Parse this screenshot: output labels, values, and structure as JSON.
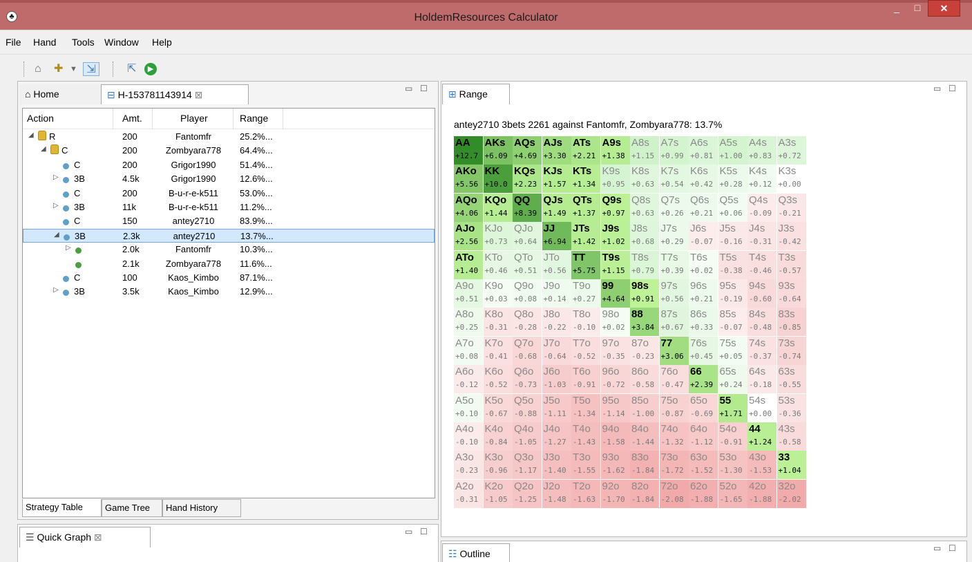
{
  "window": {
    "title": "HoldemResources Calculator",
    "minimize": "_",
    "maximize": "□",
    "close": "✕"
  },
  "menu": [
    "File",
    "Hand",
    "Tools",
    "Window",
    "Help"
  ],
  "left": {
    "tabs": {
      "home": "Home",
      "hand": "H-153781143914"
    },
    "columns": {
      "action": "Action",
      "amt": "Amt.",
      "player": "Player",
      "range": "Range"
    },
    "rows": [
      {
        "indent": 0,
        "exp": "◢",
        "icon": "lock",
        "action": "R",
        "amt": "200",
        "player": "Fantomfr",
        "range": "25.2%..."
      },
      {
        "indent": 1,
        "exp": "◢",
        "icon": "lock",
        "action": "C",
        "amt": "200",
        "player": "Zombyara778",
        "range": "64.4%..."
      },
      {
        "indent": 2,
        "exp": "",
        "icon": "dot",
        "action": "C",
        "amt": "200",
        "player": "Grigor1990",
        "range": "51.4%..."
      },
      {
        "indent": 2,
        "exp": "▷",
        "icon": "dot",
        "action": "3B",
        "amt": "4.5k",
        "player": "Grigor1990",
        "range": "12.6%..."
      },
      {
        "indent": 2,
        "exp": "",
        "icon": "dot",
        "action": "C",
        "amt": "200",
        "player": "B-u-r-e-k511",
        "range": "53.0%..."
      },
      {
        "indent": 2,
        "exp": "▷",
        "icon": "dot",
        "action": "3B",
        "amt": "11k",
        "player": "B-u-r-e-k511",
        "range": "11.2%..."
      },
      {
        "indent": 2,
        "exp": "",
        "icon": "dot",
        "action": "C",
        "amt": "150",
        "player": "antey2710",
        "range": "83.9%..."
      },
      {
        "indent": 2,
        "exp": "◢",
        "icon": "dot",
        "action": "3B",
        "amt": "2.3k",
        "player": "antey2710",
        "range": "13.7%...",
        "selected": true
      },
      {
        "indent": 3,
        "exp": "▷",
        "icon": "gdot",
        "action": "",
        "amt": "2.0k",
        "player": "Fantomfr",
        "range": "10.3%..."
      },
      {
        "indent": 3,
        "exp": "",
        "icon": "gdot",
        "action": "",
        "amt": "2.1k",
        "player": "Zombyara778",
        "range": "11.6%..."
      },
      {
        "indent": 2,
        "exp": "",
        "icon": "dot",
        "action": "C",
        "amt": "100",
        "player": "Kaos_Kimbo",
        "range": "87.1%..."
      },
      {
        "indent": 2,
        "exp": "▷",
        "icon": "dot",
        "action": "3B",
        "amt": "3.5k",
        "player": "Kaos_Kimbo",
        "range": "12.9%..."
      }
    ],
    "bottom_tabs": [
      "Strategy Table",
      "Game Tree",
      "Hand History"
    ]
  },
  "quick": {
    "tab": "Quick Graph"
  },
  "range": {
    "tab": "Range",
    "headline": "antey2710 3bets 2261 against Fantomfr, Zombyara778: 13.7%",
    "grid": [
      [
        [
          "AA",
          "+12.7"
        ],
        [
          "AKs",
          "+6.09"
        ],
        [
          "AQs",
          "+4.69"
        ],
        [
          "AJs",
          "+3.30"
        ],
        [
          "ATs",
          "+2.21"
        ],
        [
          "A9s",
          "+1.38"
        ],
        [
          "A8s",
          "+1.15"
        ],
        [
          "A7s",
          "+0.99"
        ],
        [
          "A6s",
          "+0.81"
        ],
        [
          "A5s",
          "+1.00"
        ],
        [
          "A4s",
          "+0.83"
        ],
        [
          "A3s",
          "+0.72"
        ]
      ],
      [
        [
          "AKo",
          "+5.56"
        ],
        [
          "KK",
          "+10.0"
        ],
        [
          "KQs",
          "+2.23"
        ],
        [
          "KJs",
          "+1.57"
        ],
        [
          "KTs",
          "+1.34"
        ],
        [
          "K9s",
          "+0.95"
        ],
        [
          "K8s",
          "+0.63"
        ],
        [
          "K7s",
          "+0.54"
        ],
        [
          "K6s",
          "+0.42"
        ],
        [
          "K5s",
          "+0.28"
        ],
        [
          "K4s",
          "+0.12"
        ],
        [
          "K3s",
          "+0.00"
        ]
      ],
      [
        [
          "AQo",
          "+4.06"
        ],
        [
          "KQo",
          "+1.44"
        ],
        [
          "QQ",
          "+8.39"
        ],
        [
          "QJs",
          "+1.49"
        ],
        [
          "QTs",
          "+1.37"
        ],
        [
          "Q9s",
          "+0.97"
        ],
        [
          "Q8s",
          "+0.63"
        ],
        [
          "Q7s",
          "+0.26"
        ],
        [
          "Q6s",
          "+0.21"
        ],
        [
          "Q5s",
          "+0.06"
        ],
        [
          "Q4s",
          "-0.09"
        ],
        [
          "Q3s",
          "-0.21"
        ]
      ],
      [
        [
          "AJo",
          "+2.56"
        ],
        [
          "KJo",
          "+0.73"
        ],
        [
          "QJo",
          "+0.64"
        ],
        [
          "JJ",
          "+6.94"
        ],
        [
          "JTs",
          "+1.42"
        ],
        [
          "J9s",
          "+1.02"
        ],
        [
          "J8s",
          "+0.68"
        ],
        [
          "J7s",
          "+0.29"
        ],
        [
          "J6s",
          "-0.07"
        ],
        [
          "J5s",
          "-0.16"
        ],
        [
          "J4s",
          "-0.31"
        ],
        [
          "J3s",
          "-0.42"
        ]
      ],
      [
        [
          "ATo",
          "+1.40"
        ],
        [
          "KTo",
          "+0.46"
        ],
        [
          "QTo",
          "+0.51"
        ],
        [
          "JTo",
          "+0.56"
        ],
        [
          "TT",
          "+5.75"
        ],
        [
          "T9s",
          "+1.15"
        ],
        [
          "T8s",
          "+0.79"
        ],
        [
          "T7s",
          "+0.39"
        ],
        [
          "T6s",
          "+0.02"
        ],
        [
          "T5s",
          "-0.38"
        ],
        [
          "T4s",
          "-0.46"
        ],
        [
          "T3s",
          "-0.57"
        ]
      ],
      [
        [
          "A9o",
          "+0.51"
        ],
        [
          "K9o",
          "+0.03"
        ],
        [
          "Q9o",
          "+0.08"
        ],
        [
          "J9o",
          "+0.14"
        ],
        [
          "T9o",
          "+0.27"
        ],
        [
          "99",
          "+4.64"
        ],
        [
          "98s",
          "+0.91"
        ],
        [
          "97s",
          "+0.56"
        ],
        [
          "96s",
          "+0.21"
        ],
        [
          "95s",
          "-0.19"
        ],
        [
          "94s",
          "-0.60"
        ],
        [
          "93s",
          "-0.64"
        ]
      ],
      [
        [
          "A8o",
          "+0.25"
        ],
        [
          "K8o",
          "-0.31"
        ],
        [
          "Q8o",
          "-0.28"
        ],
        [
          "J8o",
          "-0.22"
        ],
        [
          "T8o",
          "-0.10"
        ],
        [
          "98o",
          "+0.02"
        ],
        [
          "88",
          "+3.84"
        ],
        [
          "87s",
          "+0.67"
        ],
        [
          "86s",
          "+0.33"
        ],
        [
          "85s",
          "-0.07"
        ],
        [
          "84s",
          "-0.48"
        ],
        [
          "83s",
          "-0.85"
        ]
      ],
      [
        [
          "A7o",
          "+0.08"
        ],
        [
          "K7o",
          "-0.41"
        ],
        [
          "Q7o",
          "-0.68"
        ],
        [
          "J7o",
          "-0.64"
        ],
        [
          "T7o",
          "-0.52"
        ],
        [
          "97o",
          "-0.35"
        ],
        [
          "87o",
          "-0.23"
        ],
        [
          "77",
          "+3.06"
        ],
        [
          "76s",
          "+0.45"
        ],
        [
          "75s",
          "+0.05"
        ],
        [
          "74s",
          "-0.37"
        ],
        [
          "73s",
          "-0.74"
        ]
      ],
      [
        [
          "A6o",
          "-0.12"
        ],
        [
          "K6o",
          "-0.52"
        ],
        [
          "Q6o",
          "-0.73"
        ],
        [
          "J6o",
          "-1.03"
        ],
        [
          "T6o",
          "-0.91"
        ],
        [
          "96o",
          "-0.72"
        ],
        [
          "86o",
          "-0.58"
        ],
        [
          "76o",
          "-0.47"
        ],
        [
          "66",
          "+2.39"
        ],
        [
          "65s",
          "+0.24"
        ],
        [
          "64s",
          "-0.18"
        ],
        [
          "63s",
          "-0.55"
        ]
      ],
      [
        [
          "A5o",
          "+0.10"
        ],
        [
          "K5o",
          "-0.67"
        ],
        [
          "Q5o",
          "-0.88"
        ],
        [
          "J5o",
          "-1.11"
        ],
        [
          "T5o",
          "-1.34"
        ],
        [
          "95o",
          "-1.14"
        ],
        [
          "85o",
          "-1.00"
        ],
        [
          "75o",
          "-0.87"
        ],
        [
          "65o",
          "-0.69"
        ],
        [
          "55",
          "+1.71"
        ],
        [
          "54s",
          "+0.00"
        ],
        [
          "53s",
          "-0.36"
        ]
      ],
      [
        [
          "A4o",
          "-0.10"
        ],
        [
          "K4o",
          "-0.84"
        ],
        [
          "Q4o",
          "-1.05"
        ],
        [
          "J4o",
          "-1.27"
        ],
        [
          "T4o",
          "-1.43"
        ],
        [
          "94o",
          "-1.58"
        ],
        [
          "84o",
          "-1.44"
        ],
        [
          "74o",
          "-1.32"
        ],
        [
          "64o",
          "-1.12"
        ],
        [
          "54o",
          "-0.91"
        ],
        [
          "44",
          "+1.24"
        ],
        [
          "43s",
          "-0.58"
        ]
      ],
      [
        [
          "A3o",
          "-0.23"
        ],
        [
          "K3o",
          "-0.96"
        ],
        [
          "Q3o",
          "-1.17"
        ],
        [
          "J3o",
          "-1.40"
        ],
        [
          "T3o",
          "-1.55"
        ],
        [
          "93o",
          "-1.62"
        ],
        [
          "83o",
          "-1.84"
        ],
        [
          "73o",
          "-1.72"
        ],
        [
          "63o",
          "-1.52"
        ],
        [
          "53o",
          "-1.30"
        ],
        [
          "43o",
          "-1.53"
        ],
        [
          "33",
          "+1.04"
        ]
      ],
      [
        [
          "A2o",
          "-0.31"
        ],
        [
          "K2o",
          "-1.05"
        ],
        [
          "Q2o",
          "-1.25"
        ],
        [
          "J2o",
          "-1.48"
        ],
        [
          "T2o",
          "-1.63"
        ],
        [
          "92o",
          "-1.70"
        ],
        [
          "82o",
          "-1.84"
        ],
        [
          "72o",
          "-2.08"
        ],
        [
          "62o",
          "-1.88"
        ],
        [
          "52o",
          "-1.65"
        ],
        [
          "42o",
          "-1.88"
        ],
        [
          "32o",
          "-2.02"
        ]
      ]
    ],
    "bold": [
      "AA",
      "AKs",
      "AQs",
      "AJs",
      "ATs",
      "A9s",
      "AKo",
      "KK",
      "KQs",
      "KJs",
      "KTs",
      "AQo",
      "KQo",
      "QQ",
      "QJs",
      "QTs",
      "Q9s",
      "AJo",
      "JJ",
      "JTs",
      "J9s",
      "ATo",
      "TT",
      "T9s",
      "99",
      "98s",
      "88",
      "77",
      "66",
      "55",
      "44",
      "33"
    ]
  },
  "outline": {
    "tab": "Outline"
  }
}
